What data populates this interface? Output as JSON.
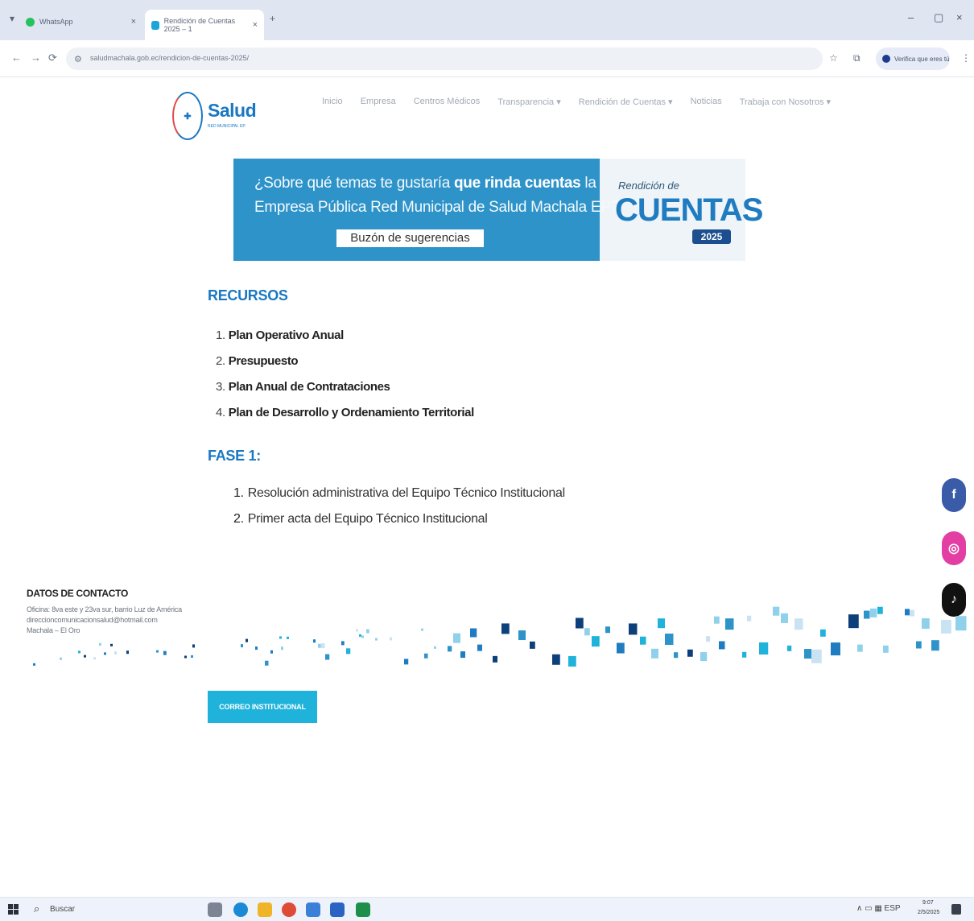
{
  "browser": {
    "tabs": [
      {
        "label": "WhatsApp"
      },
      {
        "label": "Rendición de Cuentas 2025 – 1"
      }
    ],
    "tab_close": "×",
    "new_tab": "+",
    "window_controls": {
      "minimize": "–",
      "maximize": "▢",
      "close": "×"
    },
    "nav": {
      "back": "←",
      "forward": "→",
      "reload": "⟳"
    },
    "url": "saludmachala.gob.ec/rendicion-de-cuentas-2025/",
    "site_info": "⚙",
    "bookmark": "☆",
    "extensions": "⧉",
    "profile_label": "Verifica que eres tú",
    "menu": "⋮"
  },
  "site": {
    "logo_name": "Salud",
    "logo_sub": "RED MUNICIPAL EP",
    "nav": [
      "Inicio",
      "Empresa",
      "Centros Médicos",
      "Transparencia ▾",
      "Rendición de Cuentas ▾",
      "Noticias",
      "Trabaja con Nosotros ▾"
    ]
  },
  "banner": {
    "q1_pre": "¿Sobre qué temas te gustaría ",
    "q1_bold": "que rinda cuentas",
    "q1_post": " la",
    "q2": "Empresa Pública Red Municipal de Salud Machala EP?",
    "button": "Buzón de sugerencias",
    "right_small": "Rendición de",
    "right_big": "CUENTAS",
    "right_year": "2025"
  },
  "recursos": {
    "title": "RECURSOS",
    "items": [
      {
        "n": "1.",
        "t": "Plan Operativo Anual"
      },
      {
        "n": "2.",
        "t": "Presupuesto"
      },
      {
        "n": "3.",
        "t": "Plan Anual de Contrataciones"
      },
      {
        "n": "4.",
        "t": "Plan de Desarrollo y Ordenamiento Territorial"
      }
    ]
  },
  "fase": {
    "title": "FASE 1:",
    "items": [
      {
        "n": "1.",
        "t": "Resolución administrativa del Equipo Técnico Institucional"
      },
      {
        "n": "2.",
        "t": "Primer acta del Equipo Técnico Institucional"
      }
    ]
  },
  "social": {
    "facebook": "f",
    "instagram": "◎",
    "tiktok": "♪"
  },
  "contact": {
    "title": "DATOS DE CONTACTO",
    "lines": [
      "Oficina: 8va este y 23va sur, barrio Luz de América",
      "direccioncomunicacionsalud@hotmail.com",
      "Machala – El Oro"
    ]
  },
  "correo_button": "CORREO INSTITUCIONAL",
  "taskbar": {
    "search_icon": "⌕",
    "search": "Buscar",
    "tray": "∧  ▭  ▦  ESP",
    "time": "9:07",
    "date": "2/5/2025"
  },
  "colors": {
    "brand_blue": "#1a78c2",
    "banner_blue": "#2d93c9",
    "button_cyan": "#1fb2da"
  }
}
